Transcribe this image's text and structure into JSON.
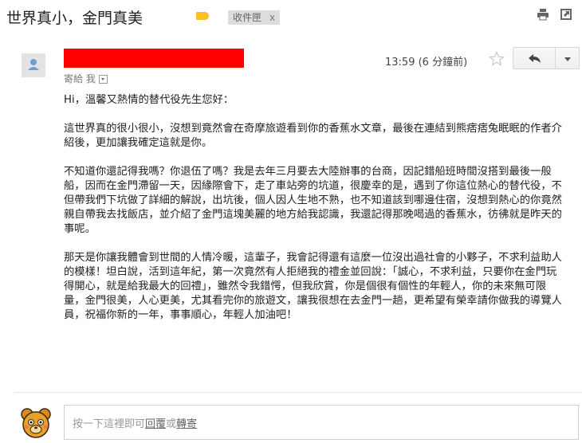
{
  "header": {
    "subject": "世界真小，金門真美",
    "label": "收件匣",
    "label_close": "x",
    "colors": {
      "label_tag": "#f6c026",
      "label_bg": "#dddddd"
    }
  },
  "message": {
    "sender_redacted_color": "#ff0000",
    "time": "13:59 (6 分鐘前)",
    "to_line": "寄給 我",
    "body": [
      "Hi，溫馨又熱情的替代役先生您好：",
      "這世界真的很小很小，沒想到竟然會在奇摩旅遊看到你的香蕉水文章，最後在連結到熊痞痞兔眠眠的作者介紹後，更加讓我確定這就是你。",
      "不知道你還記得我嗎？你退伍了嗎？我是去年三月要去大陸辦事的台商，因記錯船班時間沒搭到最後一般船，因而在金門滯留一天，因緣際會下，走了車站旁的坑道，很慶幸的是，遇到了你這位熱心的替代役，不但帶我們下坑做了詳細的解說，出坑後，個人因人生地不熟，也不知道該到哪邊住宿，沒想到熱心的你竟然親自帶我去找飯店，並介紹了金門這塊美麗的地方給我認識，我還記得那晚喝過的香蕉水，彷彿就是昨天的事呢。",
      "那天是你讓我體會到世間的人情冷暖，這輩子，我會記得還有這麼一位沒出過社會的小夥子，不求利益助人的模樣！坦白說，活到這年紀，第一次竟然有人拒絕我的禮金並回說：「誠心，不求利益，只要你在金門玩得開心，就是給我最大的回禮」，雖然令我錯愕，但我欣賞，你是個很有個性的年輕人，你的未來無可限量，金門很美，人心更美，尤其看完你的旅遊文，讓我很想在去金門一趟，更希望有榮幸請你做我的導覽人員，祝福你新的一年，事事順心，年輕人加油吧！"
    ]
  },
  "reply": {
    "prefix": "按一下這裡即可",
    "reply_link": "回覆",
    "or": "或",
    "forward_link": "轉寄"
  },
  "icons": [
    "print-icon",
    "popout-icon",
    "star-icon",
    "reply-arrow-icon",
    "more-dropdown-icon",
    "person-icon",
    "bear-avatar-icon"
  ]
}
